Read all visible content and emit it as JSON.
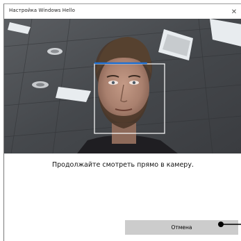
{
  "window": {
    "title": "Настройка Windows Hello",
    "close_glyph": "✕",
    "close_icon": "close-icon"
  },
  "camera": {
    "face_frame_color": "#ffffff",
    "scan_progress_color": "#1f6fd1",
    "scan_progress": 0.75
  },
  "instruction": "Продолжайте смотреть прямо в камеру.",
  "actions": {
    "cancel_label": "Отмена"
  },
  "colors": {
    "button_bg": "#cccccc",
    "window_bg": "#ffffff"
  }
}
